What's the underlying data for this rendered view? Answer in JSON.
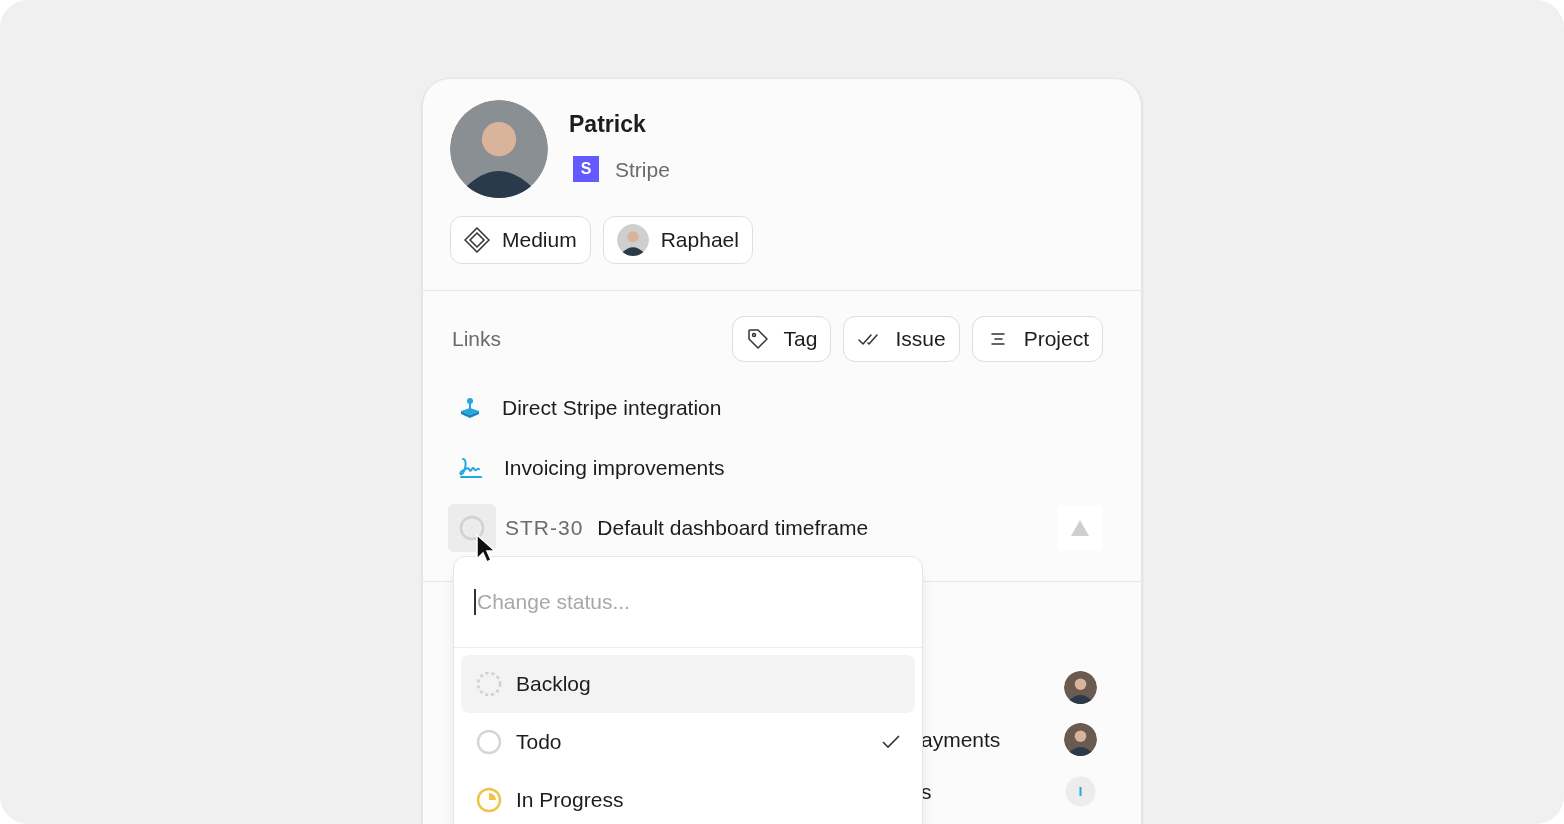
{
  "person": {
    "name": "Patrick",
    "company": "Stripe",
    "company_logo_letter": "S"
  },
  "chips": [
    {
      "kind": "priority",
      "label": "Medium"
    },
    {
      "kind": "assignee",
      "label": "Raphael"
    }
  ],
  "links": {
    "title": "Links",
    "actions": [
      {
        "kind": "tag",
        "label": "Tag"
      },
      {
        "kind": "issue",
        "label": "Issue"
      },
      {
        "kind": "project",
        "label": "Project"
      }
    ],
    "items": [
      {
        "kind": "joystick",
        "label": "Direct Stripe integration"
      },
      {
        "kind": "signature",
        "label": "Invoicing improvements"
      }
    ],
    "issue": {
      "id": "STR-30",
      "title": "Default dashboard timeframe"
    }
  },
  "background_rows": [
    {
      "kind": "avatar"
    },
    {
      "kind": "avatar",
      "text": "ayments"
    },
    {
      "kind": "progress",
      "text": "s"
    }
  ],
  "status_menu": {
    "placeholder": "Change status...",
    "options": [
      {
        "kind": "backlog",
        "label": "Backlog",
        "selected": true,
        "checked": false
      },
      {
        "kind": "todo",
        "label": "Todo",
        "selected": false,
        "checked": true
      },
      {
        "kind": "in_progress",
        "label": "In Progress",
        "selected": false,
        "checked": false
      }
    ]
  }
}
